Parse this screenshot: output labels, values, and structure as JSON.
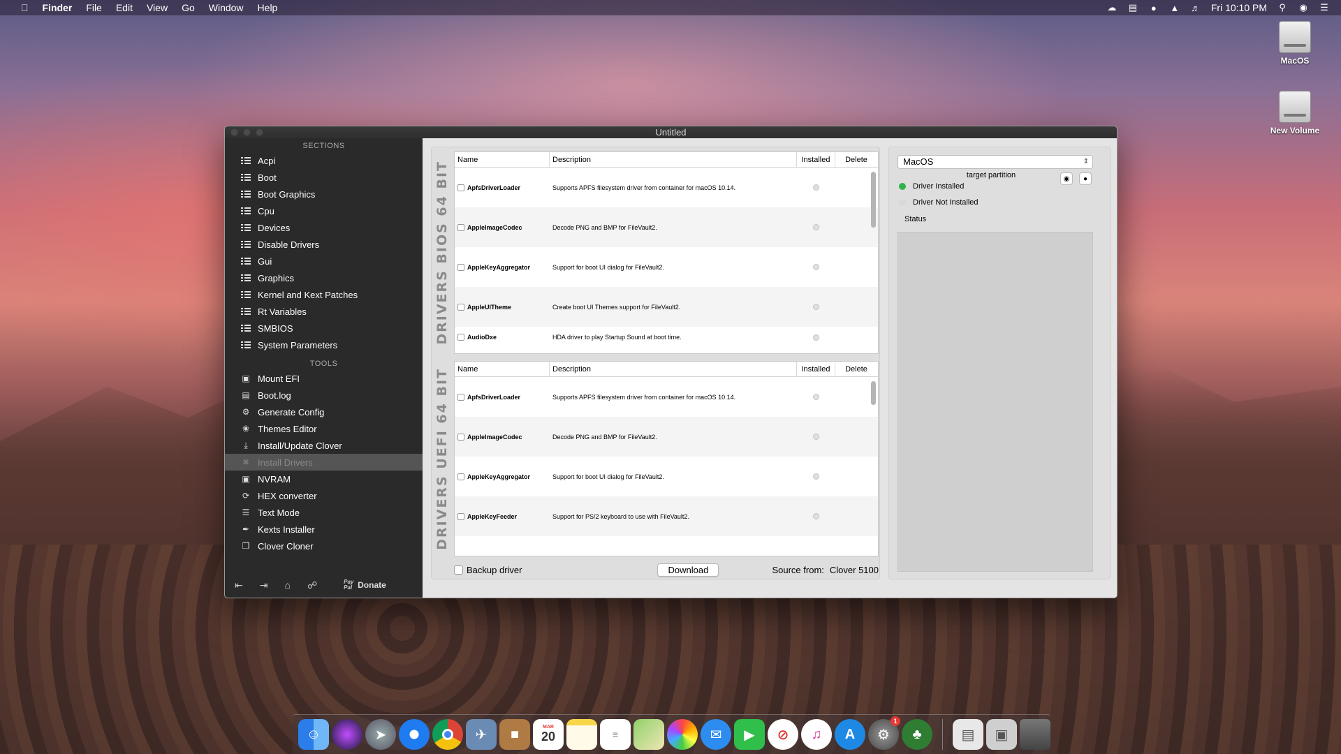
{
  "menubar": {
    "app": "Finder",
    "menus": [
      "File",
      "Edit",
      "View",
      "Go",
      "Window",
      "Help"
    ],
    "clock": "Fri 10:10 PM"
  },
  "desktop": {
    "icons": [
      {
        "label": "MacOS",
        "icon": "hard-drive-icon"
      },
      {
        "label": "New Volume",
        "icon": "hard-drive-icon"
      }
    ]
  },
  "window": {
    "title": "Untitled",
    "sidebar": {
      "sections_title": "SECTIONS",
      "sections": [
        "Acpi",
        "Boot",
        "Boot Graphics",
        "Cpu",
        "Devices",
        "Disable Drivers",
        "Gui",
        "Graphics",
        "Kernel and Kext Patches",
        "Rt Variables",
        "SMBIOS",
        "System Parameters"
      ],
      "tools_title": "TOOLS",
      "tools": [
        "Mount EFI",
        "Boot.log",
        "Generate Config",
        "Themes Editor",
        "Install/Update Clover",
        "Install Drivers",
        "NVRAM",
        "HEX converter",
        "Text Mode",
        "Kexts Installer",
        "Clover Cloner"
      ],
      "active_tool": "Install Drivers",
      "donate_label": "Donate",
      "paypal_label": "Pay Pal"
    },
    "bios_table": {
      "side_label": "DRIVERS BIOS 64 BIT",
      "columns": [
        "Name",
        "Description",
        "Installed",
        "Delete"
      ],
      "rows": [
        {
          "name": "ApfsDriverLoader",
          "description": "Supports APFS filesystem driver from container for macOS 10.14."
        },
        {
          "name": "AppleImageCodec",
          "description": "Decode PNG and BMP for FileVault2."
        },
        {
          "name": "AppleKeyAggregator",
          "description": "Support for boot UI dialog for FileVault2."
        },
        {
          "name": "AppleUITheme",
          "description": "Create boot UI Themes support for FileVault2."
        },
        {
          "name": "AudioDxe",
          "description": "HDA driver to play Startup Sound at boot time."
        }
      ]
    },
    "uefi_table": {
      "side_label": "DRIVERS UEFI 64 BIT",
      "columns": [
        "Name",
        "Description",
        "Installed",
        "Delete"
      ],
      "rows": [
        {
          "name": "ApfsDriverLoader",
          "description": "Supports APFS filesystem driver from container for macOS 10.14."
        },
        {
          "name": "AppleImageCodec",
          "description": "Decode PNG and BMP for FileVault2."
        },
        {
          "name": "AppleKeyAggregator",
          "description": "Support for boot UI dialog for FileVault2."
        },
        {
          "name": "AppleKeyFeeder",
          "description": "Support for PS/2 keyboard to use with FileVault2."
        }
      ]
    },
    "footer": {
      "backup_label": "Backup driver",
      "download_label": "Download",
      "source_label": "Source from:",
      "source_value": "Clover 5100"
    },
    "right_panel": {
      "partition_value": "MacOS",
      "partition_caption": "target partition",
      "legend_installed": "Driver Installed",
      "legend_not_installed": "Driver Not Installed",
      "status_label": "Status",
      "installed_color": "#2fb24a",
      "not_installed_color": "#d9d9d9"
    }
  },
  "dock": {
    "apps": [
      "finder-icon",
      "siri-icon",
      "launchpad-icon",
      "safari-icon",
      "chrome-icon",
      "preview-icon",
      "contacts-icon",
      "calendar-icon",
      "notes-icon",
      "reminders-icon",
      "maps-icon",
      "photos-icon",
      "messages-icon",
      "facetime-icon",
      "news-icon",
      "itunes-icon",
      "app-store-icon",
      "system-preferences-icon",
      "clover-configurator-icon"
    ],
    "calendar_month": "MAR",
    "calendar_day": "20",
    "prefs_badge": "1"
  }
}
